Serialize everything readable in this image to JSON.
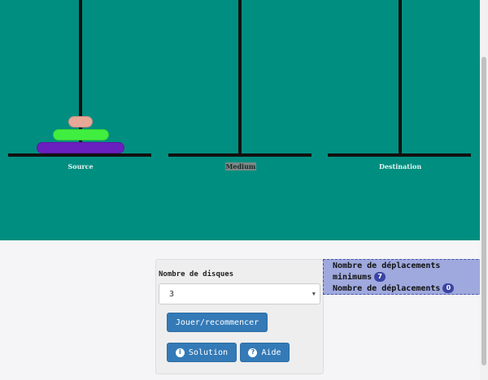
{
  "pegs": [
    {
      "id": "source",
      "label": "Source",
      "selected": false
    },
    {
      "id": "medium",
      "label": "Medium",
      "selected": true
    },
    {
      "id": "destination",
      "label": "Destination",
      "selected": false
    }
  ],
  "disks": [
    {
      "peg": "source",
      "size": 3,
      "color": "#6a1fbf"
    },
    {
      "peg": "source",
      "size": 2,
      "color": "#40ee40"
    },
    {
      "peg": "source",
      "size": 1,
      "color": "#e8a898"
    }
  ],
  "colors": {
    "board": "#008e80",
    "button": "#337ab7",
    "stats_bg": "#9fa9de",
    "badge": "#3a45a3"
  },
  "controls": {
    "disk_count_label": "Nombre de disques",
    "disk_count_value": "3",
    "play_label": "Jouer/recommencer",
    "solution_label": "Solution",
    "solution_icon": "info-circle-icon",
    "help_label": "Aide",
    "help_icon": "question-circle-icon"
  },
  "stats": {
    "min_moves_label": "Nombre de déplacements minimums",
    "min_moves_value": "7",
    "moves_label": "Nombre de déplacements",
    "moves_value": "0"
  }
}
